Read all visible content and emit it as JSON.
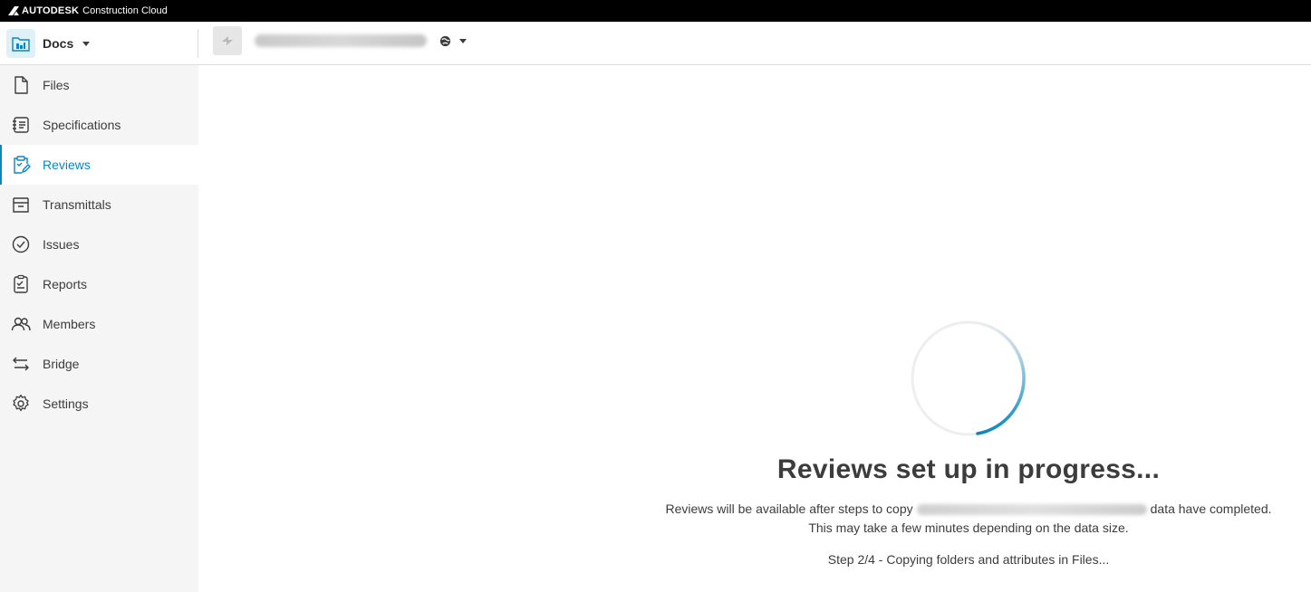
{
  "brand": {
    "name": "AUTODESK",
    "product": "Construction Cloud"
  },
  "header": {
    "module_label": "Docs",
    "module_icon": "docs-folder-icon",
    "project_icon": "project-thumbnail-icon",
    "visibility_icon": "globe-icon"
  },
  "sidebar": {
    "items": [
      {
        "label": "Files",
        "icon": "file-icon"
      },
      {
        "label": "Specifications",
        "icon": "specifications-icon"
      },
      {
        "label": "Reviews",
        "icon": "reviews-icon",
        "active": true
      },
      {
        "label": "Transmittals",
        "icon": "transmittals-icon"
      },
      {
        "label": "Issues",
        "icon": "issues-icon"
      },
      {
        "label": "Reports",
        "icon": "reports-icon"
      },
      {
        "label": "Members",
        "icon": "members-icon"
      },
      {
        "label": "Bridge",
        "icon": "bridge-icon"
      },
      {
        "label": "Settings",
        "icon": "gear-icon"
      }
    ]
  },
  "loading": {
    "title": "Reviews set up in progress...",
    "desc_prefix": "Reviews will be available after steps to copy",
    "desc_suffix": "data have completed.",
    "desc_line2": "This may take a few minutes depending on the data size.",
    "step": "Step 2/4 - Copying folders and attributes in Files..."
  },
  "colors": {
    "accent": "#0a87bf",
    "sidebar_bg": "#f5f5f5",
    "brand_bar": "#000000"
  }
}
